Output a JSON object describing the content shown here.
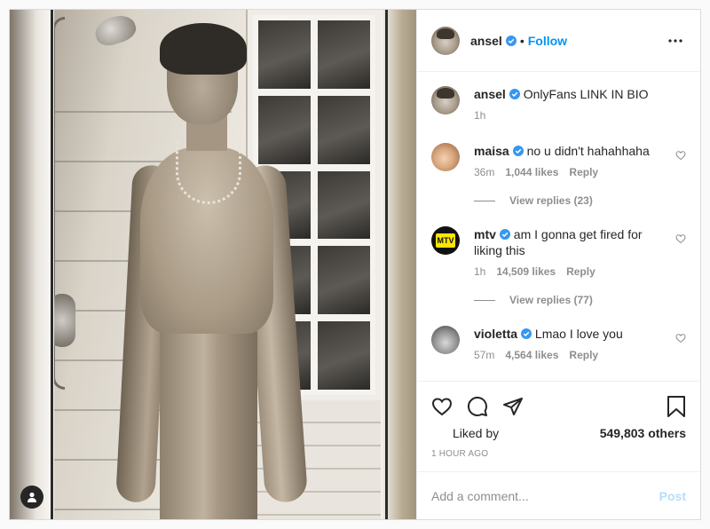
{
  "colors": {
    "link_blue": "#0095f6",
    "verified_blue": "#3897f0",
    "muted": "#8e8e8e",
    "post_disabled": "#b2dffc"
  },
  "header": {
    "username": "ansel",
    "separator": "•",
    "follow_label": "Follow",
    "more_icon": "more-horizontal-icon"
  },
  "caption": {
    "username": "ansel",
    "text": "OnlyFans LINK IN BIO",
    "time": "1h"
  },
  "comments": [
    {
      "username": "maisa",
      "text": "no u didn't hahahhaha",
      "time": "36m",
      "likes": "1,044 likes",
      "reply": "Reply",
      "view_replies": "View replies (23)"
    },
    {
      "username": "mtv",
      "avatar_text": "MTV",
      "text": "am I gonna get fired for liking this",
      "time": "1h",
      "likes": "14,509 likes",
      "reply": "Reply",
      "view_replies": "View replies (77)"
    },
    {
      "username": "violetta",
      "text": "Lmao I love you",
      "time": "57m",
      "likes": "4,564 likes",
      "reply": "Reply"
    }
  ],
  "actions": {
    "icons": [
      "heart-icon",
      "comment-icon",
      "share-icon",
      "bookmark-icon"
    ],
    "liked_by_label": "Liked by",
    "others": "549,803 others",
    "timestamp": "1 HOUR AGO"
  },
  "add_comment": {
    "placeholder": "Add a comment...",
    "post_label": "Post"
  }
}
